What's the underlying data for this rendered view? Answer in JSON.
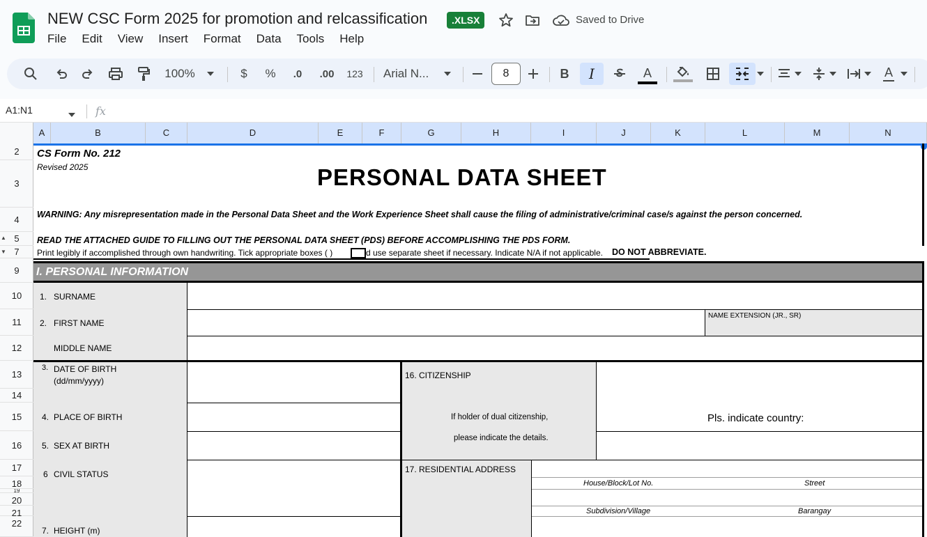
{
  "app": {
    "doc_title": "NEW CSC Form 2025 for promotion and relcassification",
    "file_badge": ".XLSX",
    "save_status": "Saved to Drive",
    "menu": [
      "File",
      "Edit",
      "View",
      "Insert",
      "Format",
      "Data",
      "Tools",
      "Help"
    ]
  },
  "toolbar": {
    "zoom": "100%",
    "currency": "$",
    "percent": "%",
    "dec_decrease": ".0",
    "dec_increase": ".00",
    "number_format": "123",
    "font_name": "Arial N...",
    "font_size": "8",
    "bold": "B",
    "italic": "I",
    "text_color": "A",
    "text_rotation": "A"
  },
  "formula_bar": {
    "name_box": "A1:N1",
    "fx": "fx"
  },
  "columns": [
    "A",
    "B",
    "C",
    "D",
    "E",
    "F",
    "G",
    "H",
    "I",
    "J",
    "K",
    "L",
    "M",
    "N"
  ],
  "rows": [
    "2",
    "3",
    "4",
    "5",
    "7",
    "9",
    "10",
    "11",
    "12",
    "13",
    "14",
    "15",
    "16",
    "17",
    "18",
    "19",
    "20",
    "21",
    "22"
  ],
  "form": {
    "form_no": "CS Form No. 212",
    "revised": "Revised 2025",
    "title": "PERSONAL DATA SHEET",
    "warning": "WARNING: Any misrepresentation made in the Personal Data Sheet and the Work Experience Sheet shall cause the filing of administrative/criminal case/s against the person concerned.",
    "read_guide": "READ THE ATTACHED GUIDE TO FILLING OUT THE PERSONAL DATA SHEET (PDS) BEFORE ACCOMPLISHING THE PDS FORM.",
    "instructions_a": "Print legibly if accomplished through own handwriting. Tick appropriate boxes  (      )",
    "instructions_b": "d use separate sheet if necessary. Indicate N/A if not applicable.",
    "instructions_c": "DO NOT ABBREVIATE.",
    "section1": "I. PERSONAL INFORMATION",
    "surname_no": "1.",
    "surname": "SURNAME",
    "firstname_no": "2.",
    "firstname": "FIRST NAME",
    "name_ext": "NAME EXTENSION (JR., SR)",
    "middlename": "MIDDLE NAME",
    "dob_no": "3.",
    "dob": "DATE OF BIRTH",
    "dob_fmt": "(dd/mm/yyyy)",
    "citizenship": "16. CITIZENSHIP",
    "dual_1": "If holder of  dual citizenship,",
    "dual_2": "please indicate the details.",
    "indicate_country": "Pls. indicate country:",
    "pob_no": "4.",
    "pob": "PLACE OF BIRTH",
    "sex_no": "5.",
    "sex": "SEX AT BIRTH",
    "civil_no": "6",
    "civil": "CIVIL STATUS",
    "residential": "17. RESIDENTIAL ADDRESS",
    "house": "House/Block/Lot No.",
    "street": "Street",
    "subdivision": "Subdivision/Village",
    "barangay": "Barangay",
    "height_no": "7.",
    "height": "HEIGHT (m)"
  }
}
